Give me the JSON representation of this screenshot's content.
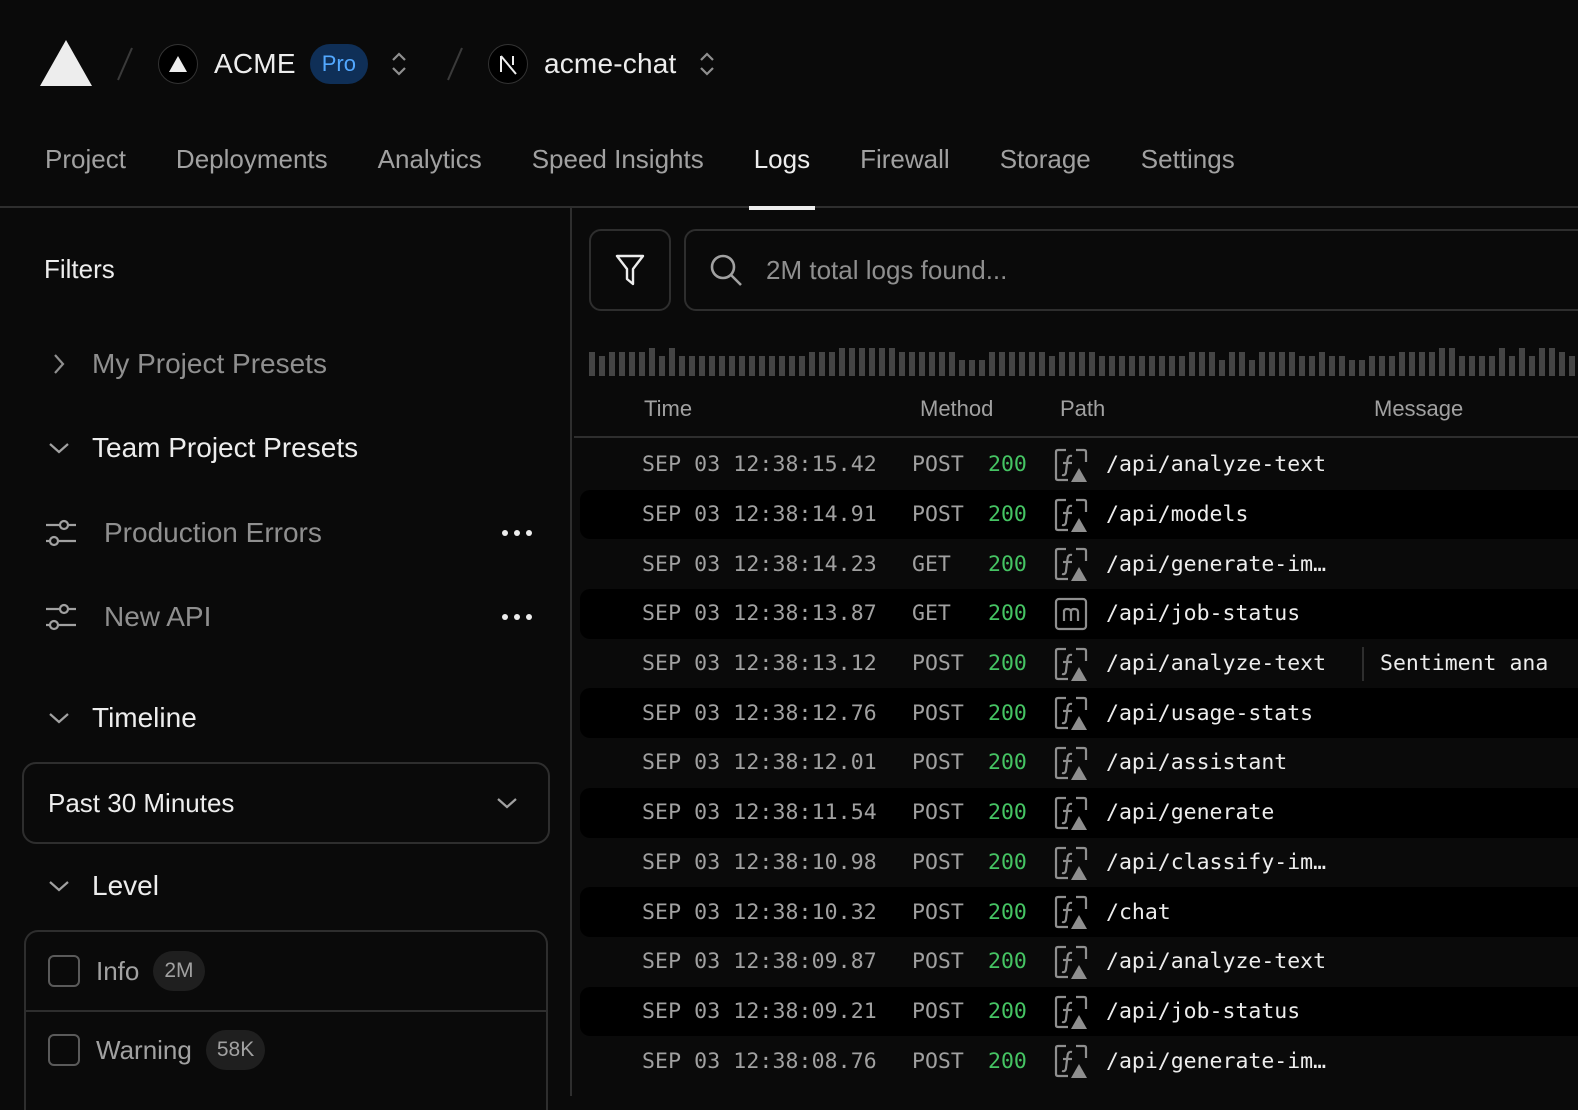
{
  "header": {
    "logo": "vercel-triangle-icon",
    "team": {
      "name": "ACME",
      "badge": "Pro",
      "avatar": "triangle-icon"
    },
    "project": {
      "name": "acme-chat",
      "avatar": "nextjs-n-icon"
    }
  },
  "tabs": [
    {
      "label": "Project",
      "active": false
    },
    {
      "label": "Deployments",
      "active": false
    },
    {
      "label": "Analytics",
      "active": false
    },
    {
      "label": "Speed Insights",
      "active": false
    },
    {
      "label": "Logs",
      "active": true
    },
    {
      "label": "Firewall",
      "active": false
    },
    {
      "label": "Storage",
      "active": false
    },
    {
      "label": "Settings",
      "active": false
    }
  ],
  "sidebar": {
    "title": "Filters",
    "my_presets": {
      "label": "My Project Presets",
      "expanded": false
    },
    "team_presets": {
      "label": "Team Project Presets",
      "expanded": true,
      "items": [
        {
          "label": "Production Errors"
        },
        {
          "label": "New API"
        }
      ]
    },
    "timeline": {
      "label": "Timeline",
      "selected": "Past 30 Minutes"
    },
    "level": {
      "label": "Level",
      "options": [
        {
          "label": "Info",
          "count": "2M",
          "checked": false
        },
        {
          "label": "Warning",
          "count": "58K",
          "checked": false
        }
      ]
    }
  },
  "search": {
    "placeholder": "2M total logs found...",
    "value": ""
  },
  "histogram": {
    "description": "relative log volume per time bucket, level 0 (lowest) to 3 (highest)",
    "levels": [
      2,
      1,
      2,
      2,
      2,
      2,
      3,
      1,
      3,
      1,
      1,
      1,
      1,
      1,
      1,
      1,
      1,
      1,
      1,
      1,
      1,
      1,
      2,
      2,
      2,
      3,
      3,
      3,
      3,
      3,
      3,
      2,
      2,
      2,
      2,
      2,
      2,
      0,
      0,
      0,
      2,
      2,
      2,
      2,
      2,
      2,
      1,
      2,
      2,
      2,
      2,
      1,
      1,
      1,
      1,
      1,
      1,
      1,
      1,
      1,
      2,
      2,
      2,
      0,
      2,
      2,
      0,
      2,
      2,
      2,
      2,
      1,
      1,
      2,
      1,
      1,
      0,
      0,
      1,
      1,
      1,
      2,
      2,
      2,
      2,
      3,
      3,
      1,
      1,
      1,
      1,
      3,
      1,
      3,
      1,
      3,
      3,
      2,
      1
    ]
  },
  "table": {
    "columns": {
      "time": "Time",
      "method": "Method",
      "path": "Path",
      "message": "Message"
    },
    "rows": [
      {
        "time": "SEP 03 12:38:15.42",
        "method": "POST",
        "status": "200",
        "type": "function",
        "path": "/api/analyze-text",
        "message": ""
      },
      {
        "time": "SEP 03 12:38:14.91",
        "method": "POST",
        "status": "200",
        "type": "function",
        "path": "/api/models",
        "message": ""
      },
      {
        "time": "SEP 03 12:38:14.23",
        "method": "GET",
        "status": "200",
        "type": "function",
        "path": "/api/generate-im…",
        "message": ""
      },
      {
        "time": "SEP 03 12:38:13.87",
        "method": "GET",
        "status": "200",
        "type": "middleware",
        "path": "/api/job-status",
        "message": ""
      },
      {
        "time": "SEP 03 12:38:13.12",
        "method": "POST",
        "status": "200",
        "type": "function",
        "path": "/api/analyze-text",
        "message": "Sentiment ana"
      },
      {
        "time": "SEP 03 12:38:12.76",
        "method": "POST",
        "status": "200",
        "type": "function",
        "path": "/api/usage-stats",
        "message": ""
      },
      {
        "time": "SEP 03 12:38:12.01",
        "method": "POST",
        "status": "200",
        "type": "function",
        "path": "/api/assistant",
        "message": ""
      },
      {
        "time": "SEP 03 12:38:11.54",
        "method": "POST",
        "status": "200",
        "type": "function",
        "path": "/api/generate",
        "message": ""
      },
      {
        "time": "SEP 03 12:38:10.98",
        "method": "POST",
        "status": "200",
        "type": "function",
        "path": "/api/classify-im…",
        "message": ""
      },
      {
        "time": "SEP 03 12:38:10.32",
        "method": "POST",
        "status": "200",
        "type": "function",
        "path": "/chat",
        "message": ""
      },
      {
        "time": "SEP 03 12:38:09.87",
        "method": "POST",
        "status": "200",
        "type": "function",
        "path": "/api/analyze-text",
        "message": ""
      },
      {
        "time": "SEP 03 12:38:09.21",
        "method": "POST",
        "status": "200",
        "type": "function",
        "path": "/api/job-status",
        "message": ""
      },
      {
        "time": "SEP 03 12:38:08.76",
        "method": "POST",
        "status": "200",
        "type": "function",
        "path": "/api/generate-im…",
        "message": ""
      }
    ]
  },
  "colors": {
    "background": "#0a0a0a",
    "border": "#2e2e2e",
    "status_ok": "#45c463",
    "badge_bg": "#0f2f57",
    "badge_text": "#52a8ff"
  }
}
